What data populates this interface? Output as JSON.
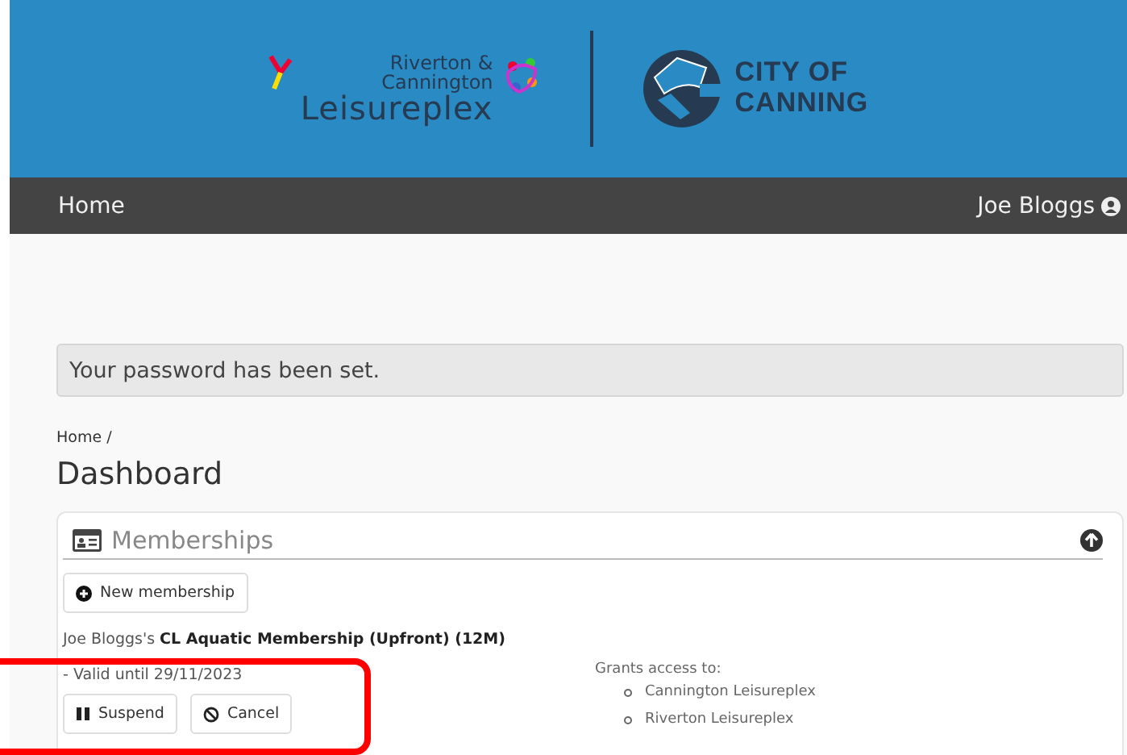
{
  "header": {
    "logo_left": {
      "line_1": "Riverton &",
      "line_2": "Cannington",
      "line_3": "Leisureplex"
    },
    "logo_right": {
      "line_1": "CITY OF",
      "line_2": "CANNING"
    }
  },
  "nav": {
    "home": "Home",
    "user": "Joe Bloggs"
  },
  "alert": "Your password has been set.",
  "breadcrumb": "Home /",
  "page_title": "Dashboard",
  "memberships": {
    "title": "Memberships",
    "expanded": true,
    "new_button": "New membership",
    "items": [
      {
        "title": "Joe Bloggs's **CL Aquatic Membership (Upfront) (12M)**",
        "valid": "- Valid until 29/11/2023",
        "actions": [
          {
            "kind": "suspend",
            "label": "Suspend"
          },
          {
            "kind": "cancel",
            "label": "Cancel"
          }
        ],
        "access_heading": "Grants access to:",
        "access": [
          "Cannington Leisureplex",
          "Riverton Leisureplex"
        ]
      }
    ]
  }
}
